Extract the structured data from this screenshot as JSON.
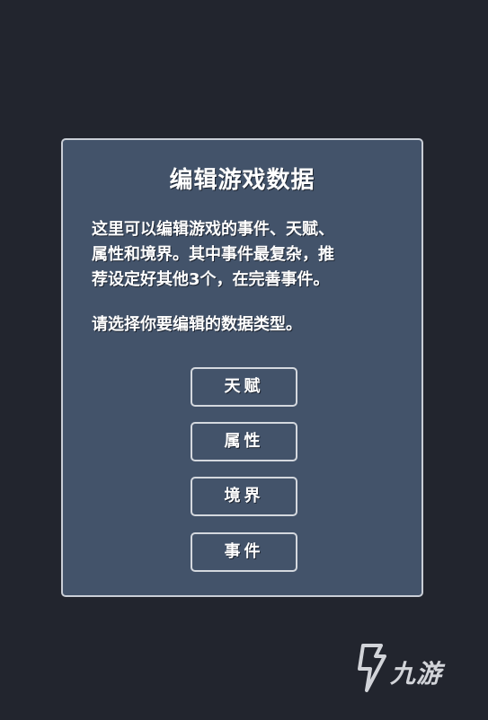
{
  "dialog": {
    "title": "编辑游戏数据",
    "description_lines": [
      "这里可以编辑游戏的事件、天赋、",
      "属性和境界。其中事件最复杂，推",
      "荐设定好其他3个，在完善事件。"
    ],
    "prompt": "请选择你要编辑的数据类型。",
    "buttons": [
      {
        "label": "天赋"
      },
      {
        "label": "属性"
      },
      {
        "label": "境界"
      },
      {
        "label": "事件"
      }
    ]
  },
  "watermark": {
    "text": "九游",
    "icon": "jiuyou-logo-icon"
  },
  "colors": {
    "background": "#22252e",
    "panel": "#43536a",
    "border": "#c9ced6",
    "text": "#ffffff"
  }
}
